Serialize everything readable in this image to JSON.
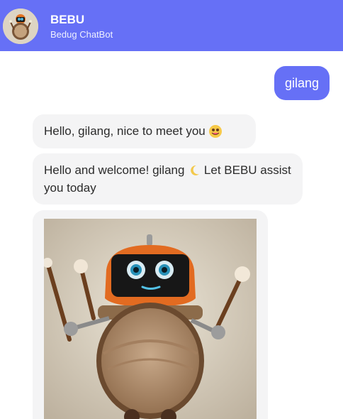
{
  "header": {
    "title": "BEBU",
    "subtitle": "Bedug ChatBot"
  },
  "messages": {
    "user": "gilang",
    "bot_1": "Hello, gilang, nice to meet you",
    "bot_2_part1": "Hello and welcome! gilang",
    "bot_2_part2": "Let BEBU assist you today"
  },
  "colors": {
    "primary": "#6670f6",
    "bot_bubble": "#f4f4f5"
  },
  "icons": {
    "bot_1_emoji": "smiling-face-emoji",
    "bot_2_emoji": "crescent-moon-emoji"
  }
}
